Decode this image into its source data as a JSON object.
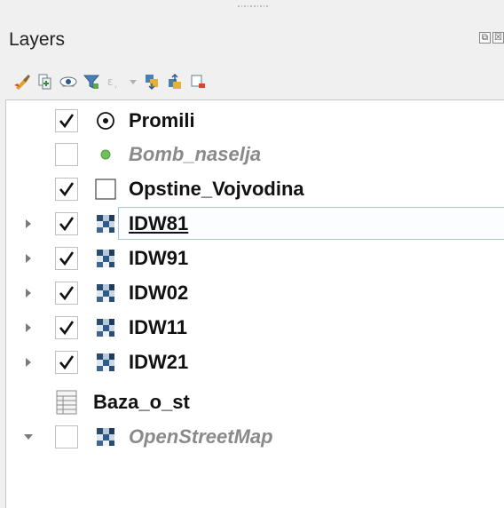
{
  "panel": {
    "title": "Layers",
    "buttons": [
      {
        "name": "float-icon",
        "glyph": "⧉"
      },
      {
        "name": "close-icon",
        "glyph": "☒"
      }
    ]
  },
  "toolbar": [
    {
      "name": "style-brush-icon"
    },
    {
      "name": "add-group-icon"
    },
    {
      "name": "manage-visibility-icon"
    },
    {
      "name": "filter-legend-icon"
    },
    {
      "name": "filter-expression-icon"
    },
    {
      "name": "dropdown-icon"
    },
    {
      "name": "expand-all-icon"
    },
    {
      "name": "collapse-all-icon"
    },
    {
      "name": "remove-layer-icon"
    }
  ],
  "layers": [
    {
      "label": "Promili",
      "checked": true,
      "icon": "point-circle-icon",
      "expander": "none",
      "style": "bold"
    },
    {
      "label": "Bomb_naselja",
      "checked": false,
      "icon": "point-dot-icon",
      "expander": "none",
      "style": "disabled"
    },
    {
      "label": "Opstine_Vojvodina",
      "checked": true,
      "icon": "polygon-icon",
      "expander": "none",
      "style": "bold"
    },
    {
      "label": "IDW81",
      "checked": true,
      "icon": "raster-icon",
      "expander": "collapsed",
      "style": "selected"
    },
    {
      "label": "IDW91",
      "checked": true,
      "icon": "raster-icon",
      "expander": "collapsed",
      "style": "bold"
    },
    {
      "label": "IDW02",
      "checked": true,
      "icon": "raster-icon",
      "expander": "collapsed",
      "style": "bold"
    },
    {
      "label": "IDW11",
      "checked": true,
      "icon": "raster-icon",
      "expander": "collapsed",
      "style": "bold"
    },
    {
      "label": "IDW21",
      "checked": true,
      "icon": "raster-icon",
      "expander": "collapsed",
      "style": "bold"
    },
    {
      "label": "Baza_o_st",
      "checked": null,
      "icon": "table-icon",
      "expander": "none",
      "style": "bold"
    },
    {
      "label": "OpenStreetMap",
      "checked": false,
      "icon": "raster-icon",
      "expander": "expanded",
      "style": "disabled"
    }
  ],
  "colors": {
    "accent": "#a8c4e2",
    "point_dot": "#6fbf5a"
  }
}
